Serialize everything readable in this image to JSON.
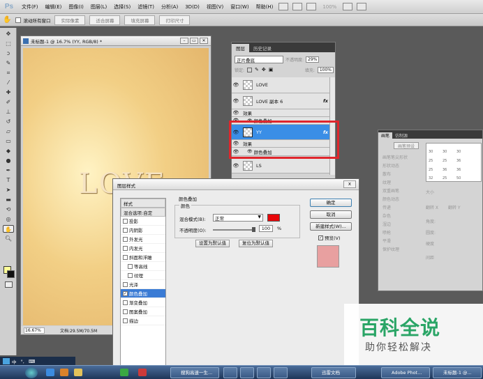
{
  "app": {
    "logo": "Ps"
  },
  "menubar": {
    "items": [
      "文件(F)",
      "编辑(E)",
      "图像(I)",
      "图层(L)",
      "选择(S)",
      "滤镜(T)",
      "分析(A)",
      "3D(D)",
      "视图(V)",
      "窗口(W)",
      "帮助(H)"
    ],
    "zoom": "100%"
  },
  "optionsbar": {
    "scroll_all_label": "滚动所有窗口",
    "buttons": [
      "实际像素",
      "适合屏幕",
      "填充屏幕",
      "打印尺寸"
    ]
  },
  "document": {
    "title": "未标题-1 @ 16.7% (YY, RGB/8) *",
    "canvas_text": "LOVE",
    "zoom": "16.67%",
    "doc_size": "文档:29.5M/70.5M"
  },
  "layers_panel": {
    "tabs": [
      "图层",
      "历史记录"
    ],
    "blend_mode": "正片叠底",
    "opacity_label": "不透明度:",
    "opacity": "29%",
    "lock_label": "锁定:",
    "fill_label": "填充:",
    "fill": "100%",
    "layers": [
      {
        "name": "LOVE"
      },
      {
        "name": "LOVE 副本 6",
        "fx": "fx",
        "effects_label": "效果",
        "effect": "颜色叠加"
      },
      {
        "name": "YY",
        "fx": "fx",
        "effects_label": "效果",
        "effect": "颜色叠加"
      },
      {
        "name": "LS"
      }
    ]
  },
  "brush_panel": {
    "tabs": [
      "画笔",
      "仿制源"
    ],
    "preset_button": "画笔预设",
    "options": [
      "画笔笔尖形状",
      "形状动态",
      "散布",
      "纹理",
      "双重画笔",
      "颜色动态",
      "传递",
      "杂色",
      "湿边",
      "喷枪",
      "平滑",
      "保护纹理"
    ],
    "sizes": [
      "30",
      "30",
      "30",
      "25",
      "25",
      "36",
      "25",
      "36",
      "36",
      "32",
      "25",
      "50"
    ],
    "size_label": "大小",
    "flip_x": "翻转 X",
    "flip_y": "翻转 Y",
    "angle_label": "角度:",
    "roundness_label": "圆度:",
    "hardness_label": "硬度",
    "spacing_label": "间距"
  },
  "layer_style_dialog": {
    "title": "图层样式",
    "close": "x",
    "styles_header": "样式",
    "blend_options": "混合选项:自定",
    "styles": [
      "投影",
      "内阴影",
      "外发光",
      "内发光",
      "斜面和浮雕",
      "等高线",
      "纹理",
      "光泽",
      "颜色叠加",
      "渐变叠加",
      "图案叠加",
      "描边"
    ],
    "selected_style": "颜色叠加",
    "section_title": "颜色叠加",
    "group_title": "颜色",
    "blend_mode_label": "混合模式(B):",
    "blend_mode": "正常",
    "overlay_color": "#e8070a",
    "opacity_label": "不透明度(O):",
    "opacity": "100",
    "opacity_unit": "%",
    "set_default": "设置为默认值",
    "reset_default": "复位为默认值",
    "ok": "确定",
    "cancel": "取消",
    "new_style": "新建样式(W)...",
    "preview_label": "预览(V)",
    "preview_color": "#e8a0a0"
  },
  "taskbar": {
    "ime": "中",
    "tasks": [
      "搜狗高速一生...",
      "",
      "",
      "",
      "迅雷文档",
      "Adobe Phot...",
      "未标题-1 @..."
    ]
  },
  "watermark": {
    "title": "百科全说",
    "subtitle": "助你轻松解决"
  },
  "colors": {
    "highlight": "#e0262c",
    "selection": "#3a7bd5",
    "watermark_green": "#2aa566"
  }
}
